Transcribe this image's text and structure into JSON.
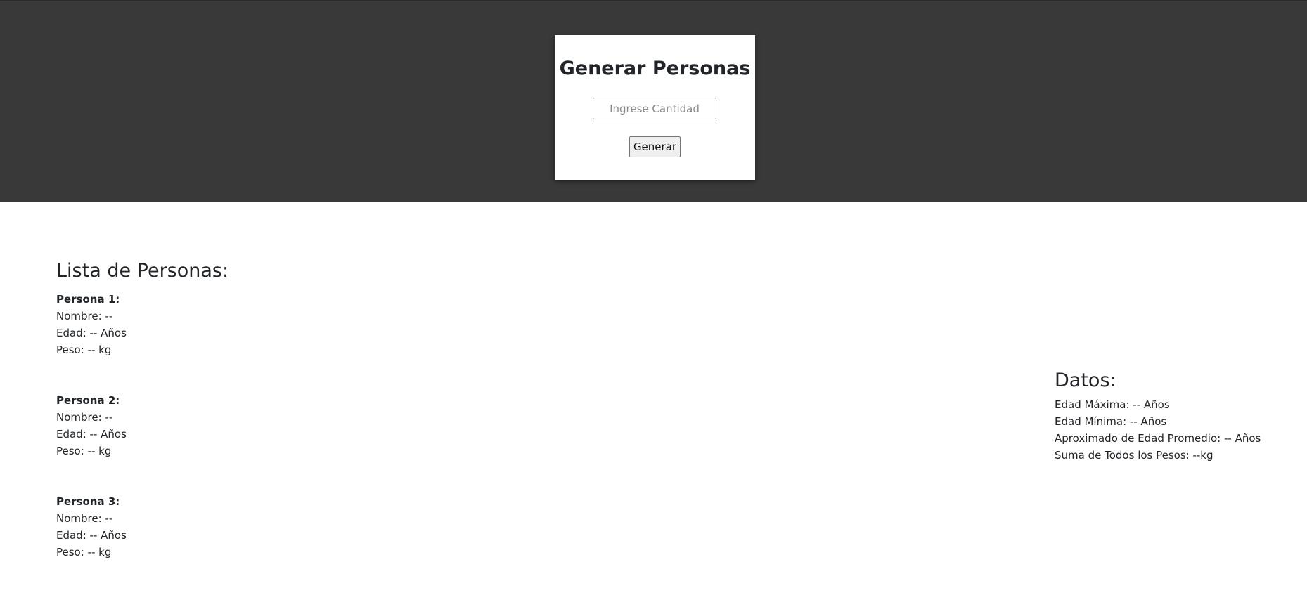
{
  "header": {
    "title": "Generar Personas",
    "input_placeholder": "Ingrese Cantidad",
    "button_label": "Generar"
  },
  "list": {
    "title": "Lista de Personas:",
    "personas": [
      {
        "title": "Persona 1:",
        "nombre": "Nombre: --",
        "edad": "Edad: -- Años",
        "peso": "Peso: -- kg"
      },
      {
        "title": "Persona 2:",
        "nombre": "Nombre: --",
        "edad": "Edad: -- Años",
        "peso": "Peso: -- kg"
      },
      {
        "title": "Persona 3:",
        "nombre": "Nombre: --",
        "edad": "Edad: -- Años",
        "peso": "Peso: -- kg"
      }
    ]
  },
  "stats": {
    "title": "Datos:",
    "edad_maxima": "Edad Máxima: -- Años",
    "edad_minima": "Edad Mínima: -- Años",
    "edad_promedio": "Aproximado de Edad Promedio: -- Años",
    "suma_pesos": "Suma de Todos los Pesos: --kg"
  },
  "colors": {
    "header_bg": "#393939",
    "card_bg": "#ffffff",
    "text": "#212529"
  }
}
